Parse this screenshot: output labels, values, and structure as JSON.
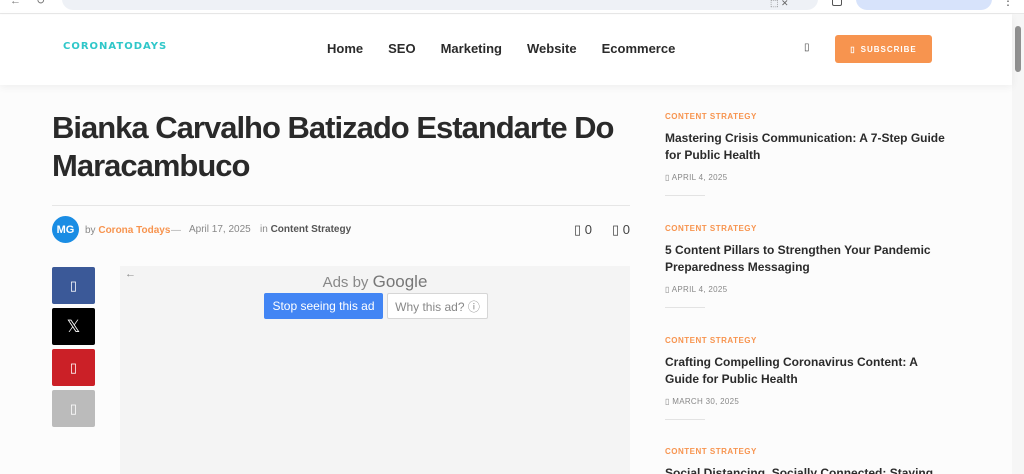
{
  "browser": {
    "back": "←",
    "reload": "↻",
    "url_icons": "⬚ ✕",
    "menu": "⋮"
  },
  "site": {
    "logo": "CORONATODAYS"
  },
  "nav": {
    "items": [
      "Home",
      "SEO",
      "Marketing",
      "Website",
      "Ecommerce"
    ]
  },
  "header": {
    "bell_glyph": "▯",
    "subscribe_glyph": "▯",
    "subscribe_label": "SUBSCRIBE"
  },
  "article": {
    "title": "Bianka Carvalho Batizado Estandarte Do Maracambuco",
    "avatar_initials": "MG",
    "by_label": "by",
    "author": "Corona Todays",
    "dash": "—",
    "date": "April 17, 2025",
    "in_label": "in",
    "category": "Content Strategy",
    "comment_count": "0",
    "share_count": "0",
    "count_glyph": "▯"
  },
  "share": {
    "facebook_glyph": "▯",
    "x_glyph": "𝕏",
    "pinterest_glyph": "▯",
    "email_glyph": "▯"
  },
  "ad": {
    "back": "←",
    "ads_by": "Ads by",
    "google": "Google",
    "stop_label": "Stop seeing this ad",
    "why_label": "Why this ad? ⓘ"
  },
  "sidebar": {
    "posts": [
      {
        "category": "CONTENT STRATEGY",
        "title": "Mastering Crisis Communication: A 7-Step Guide for Public Health",
        "date": "▯ APRIL 4, 2025"
      },
      {
        "category": "CONTENT STRATEGY",
        "title": "5 Content Pillars to Strengthen Your Pandemic Preparedness Messaging",
        "date": "▯ APRIL 4, 2025"
      },
      {
        "category": "CONTENT STRATEGY",
        "title": "Crafting Compelling Coronavirus Content: A Guide for Public Health",
        "date": "▯ MARCH 30, 2025"
      },
      {
        "category": "CONTENT STRATEGY",
        "title": "Social Distancing, Socially Connected: Staying",
        "date": ""
      }
    ]
  }
}
